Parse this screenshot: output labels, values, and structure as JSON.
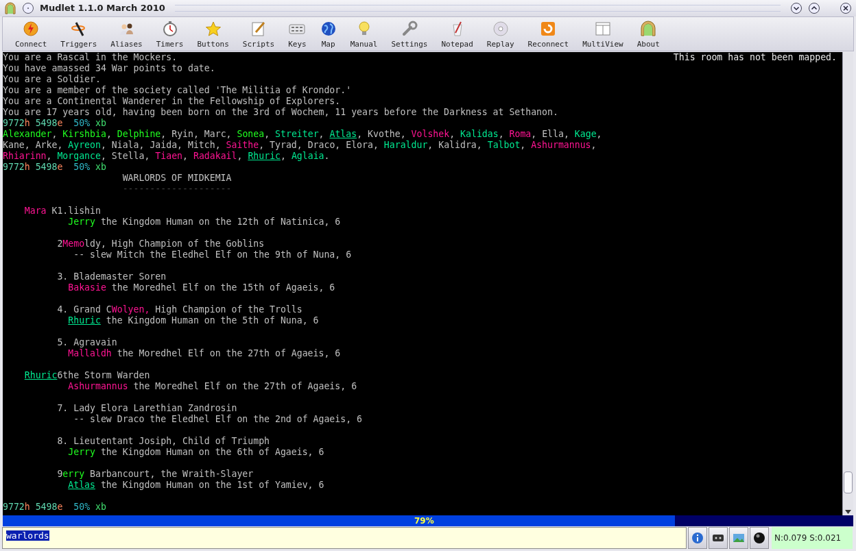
{
  "window": {
    "title": "Mudlet 1.1.0 March 2010"
  },
  "toolbar": [
    {
      "label": "Connect"
    },
    {
      "label": "Triggers"
    },
    {
      "label": "Aliases"
    },
    {
      "label": "Timers"
    },
    {
      "label": "Buttons"
    },
    {
      "label": "Scripts"
    },
    {
      "label": "Keys"
    },
    {
      "label": "Map"
    },
    {
      "label": "Manual"
    },
    {
      "label": "Settings"
    },
    {
      "label": "Notepad"
    },
    {
      "label": "Replay"
    },
    {
      "label": "Reconnect"
    },
    {
      "label": "MultiView"
    },
    {
      "label": "About"
    }
  ],
  "console": {
    "map_note": "This room has not been mapped.",
    "lines": [
      {
        "kind": "text",
        "segments": [
          {
            "text": "You are a Rascal in the Mockers."
          }
        ]
      },
      {
        "kind": "text",
        "segments": [
          {
            "text": "You have amassed 34 War points to date."
          }
        ]
      },
      {
        "kind": "text",
        "segments": [
          {
            "text": "You are a Soldier."
          }
        ]
      },
      {
        "kind": "text",
        "segments": [
          {
            "text": "You are a member of the society called 'The Militia of Krondor.'"
          }
        ]
      },
      {
        "kind": "text",
        "segments": [
          {
            "text": "You are a Continental Wanderer in the Fellowship of Explorers."
          }
        ]
      },
      {
        "kind": "text",
        "segments": [
          {
            "text": "You are 17 years old, having been born on the 3rd of Wochem, 11 years before the Darkness at Sethanon."
          }
        ]
      },
      {
        "kind": "text",
        "segments": [
          {
            "text": "9772",
            "color": "#5fd7af"
          },
          {
            "text": "h",
            "color": "#ff875f"
          },
          {
            "text": " 5498",
            "color": "#5fd7af"
          },
          {
            "text": "e",
            "color": "#ff875f"
          },
          {
            "text": "  50%",
            "color": "#30b8c8"
          },
          {
            "text": " xb",
            "color": "#40e070"
          }
        ]
      },
      {
        "kind": "text",
        "segments": [
          {
            "text": "Alexander",
            "color": "#20ff20"
          },
          {
            "text": ", "
          },
          {
            "text": "Kirshbia",
            "color": "#20ff20"
          },
          {
            "text": ", "
          },
          {
            "text": "Delphine",
            "color": "#20ff20"
          },
          {
            "text": ", Ryin, Marc, "
          },
          {
            "text": "Sonea",
            "color": "#20ff20"
          },
          {
            "text": ", "
          },
          {
            "text": "Streiter",
            "color": "#00e890"
          },
          {
            "text": ", "
          },
          {
            "text": "Atlas",
            "color": "#00e890",
            "underline": true
          },
          {
            "text": ", Kvothe, "
          },
          {
            "text": "Volshek",
            "color": "#ff1493"
          },
          {
            "text": ", "
          },
          {
            "text": "Kalidas",
            "color": "#00e890"
          },
          {
            "text": ", "
          },
          {
            "text": "Roma",
            "color": "#ff1493"
          },
          {
            "text": ", Ella, "
          },
          {
            "text": "Kage",
            "color": "#00e890"
          },
          {
            "text": ","
          }
        ]
      },
      {
        "kind": "text",
        "segments": [
          {
            "text": "Kane, Arke, "
          },
          {
            "text": "Ayreon",
            "color": "#00e890"
          },
          {
            "text": ", Niala, Jaida, Mitch, "
          },
          {
            "text": "Saithe",
            "color": "#ff1493"
          },
          {
            "text": ", Tyrad, Draco, Elora, "
          },
          {
            "text": "Haraldur",
            "color": "#00e890"
          },
          {
            "text": ", Kalidra, "
          },
          {
            "text": "Talbot",
            "color": "#00e890"
          },
          {
            "text": ", "
          },
          {
            "text": "Ashurmannus",
            "color": "#ff1493"
          },
          {
            "text": ","
          }
        ]
      },
      {
        "kind": "text",
        "segments": [
          {
            "text": "Rhiarinn",
            "color": "#ff1493"
          },
          {
            "text": ", "
          },
          {
            "text": "Morgance",
            "color": "#00e890"
          },
          {
            "text": ", Stella, "
          },
          {
            "text": "Tiaen",
            "color": "#ff1493"
          },
          {
            "text": ", "
          },
          {
            "text": "Radakail",
            "color": "#ff1493"
          },
          {
            "text": ", "
          },
          {
            "text": "Rhuric",
            "color": "#00e890",
            "underline": true
          },
          {
            "text": ", "
          },
          {
            "text": "Aglaia",
            "color": "#00e890"
          },
          {
            "text": "."
          }
        ]
      },
      {
        "kind": "text",
        "segments": [
          {
            "text": "9772",
            "color": "#5fd7af"
          },
          {
            "text": "h",
            "color": "#ff875f"
          },
          {
            "text": " 5498",
            "color": "#5fd7af"
          },
          {
            "text": "e",
            "color": "#ff875f"
          },
          {
            "text": "  50%",
            "color": "#30b8c8"
          },
          {
            "text": " xb",
            "color": "#40e070"
          }
        ]
      },
      {
        "kind": "text",
        "segments": [
          {
            "text": "                      WARLORDS OF MIDKEMIA"
          }
        ]
      },
      {
        "kind": "text",
        "segments": [
          {
            "text": "                      --------------------",
            "color": "#404040"
          }
        ]
      },
      {
        "kind": "blank"
      },
      {
        "kind": "text",
        "segments": [
          {
            "text": "    Mara",
            "color": "#ff1493"
          },
          {
            "text": " K1.lishin"
          }
        ]
      },
      {
        "kind": "text",
        "segments": [
          {
            "text": "            Jerry",
            "color": "#20ff20"
          },
          {
            "text": " the Kingdom Human on the 12th of Natinica, 6"
          }
        ]
      },
      {
        "kind": "blank"
      },
      {
        "kind": "text",
        "segments": [
          {
            "text": "          2"
          },
          {
            "text": "Memo",
            "color": "#ff1493"
          },
          {
            "text": "ldy, High Champion of the Goblins"
          }
        ]
      },
      {
        "kind": "text",
        "segments": [
          {
            "text": "             -- slew Mitch the Eledhel Elf on the 9th of Nuna, 6"
          }
        ]
      },
      {
        "kind": "blank"
      },
      {
        "kind": "text",
        "segments": [
          {
            "text": "          3. Blademaster Soren"
          }
        ]
      },
      {
        "kind": "text",
        "segments": [
          {
            "text": "            Bakasie",
            "color": "#ff1493"
          },
          {
            "text": " the Moredhel Elf on the 15th of Agaeis, 6"
          }
        ]
      },
      {
        "kind": "blank"
      },
      {
        "kind": "text",
        "segments": [
          {
            "text": "          4. Grand C"
          },
          {
            "text": "Wolyen,",
            "color": "#ff1493"
          },
          {
            "text": " High Champion of the Trolls"
          }
        ]
      },
      {
        "kind": "text",
        "segments": [
          {
            "text": "            Rhuric",
            "color": "#00e890",
            "underline": true
          },
          {
            "text": " the Kingdom Human on the 5th of Nuna, 6"
          }
        ]
      },
      {
        "kind": "blank"
      },
      {
        "kind": "text",
        "segments": [
          {
            "text": "          5. Agravain"
          }
        ]
      },
      {
        "kind": "text",
        "segments": [
          {
            "text": "            Mallaldh",
            "color": "#ff1493"
          },
          {
            "text": " the Moredhel Elf on the 27th of Agaeis, 6"
          }
        ]
      },
      {
        "kind": "blank"
      },
      {
        "kind": "text",
        "segments": [
          {
            "text": "    Rhuric",
            "color": "#00e890",
            "underline": true
          },
          {
            "text": "6the Storm Warden"
          }
        ]
      },
      {
        "kind": "text",
        "segments": [
          {
            "text": "            Ashurmannus",
            "color": "#ff1493"
          },
          {
            "text": " the Moredhel Elf on the 27th of Agaeis, 6"
          }
        ]
      },
      {
        "kind": "blank"
      },
      {
        "kind": "text",
        "segments": [
          {
            "text": "          7. Lady Elora Larethian Zandrosin"
          }
        ]
      },
      {
        "kind": "text",
        "segments": [
          {
            "text": "             -- slew Draco the Eledhel Elf on the 2nd of Agaeis, 6"
          }
        ]
      },
      {
        "kind": "blank"
      },
      {
        "kind": "text",
        "segments": [
          {
            "text": "          8. Lieutentant Josiph, Child of Triumph"
          }
        ]
      },
      {
        "kind": "text",
        "segments": [
          {
            "text": "            Jerry",
            "color": "#20ff20"
          },
          {
            "text": " the Kingdom Human on the 6th of Agaeis, 6"
          }
        ]
      },
      {
        "kind": "blank"
      },
      {
        "kind": "text",
        "segments": [
          {
            "text": "          9"
          },
          {
            "text": "erry",
            "color": "#20ff20"
          },
          {
            "text": " Barbancourt, the Wraith-Slayer"
          }
        ]
      },
      {
        "kind": "text",
        "segments": [
          {
            "text": "            Atlas",
            "color": "#00e890",
            "underline": true
          },
          {
            "text": " the Kingdom Human on the 1st of Yamiev, 6"
          }
        ]
      },
      {
        "kind": "blank"
      },
      {
        "kind": "text",
        "segments": [
          {
            "text": "9772",
            "color": "#5fd7af"
          },
          {
            "text": "h",
            "color": "#ff875f"
          },
          {
            "text": " 5498",
            "color": "#5fd7af"
          },
          {
            "text": "e",
            "color": "#ff875f"
          },
          {
            "text": "  50%",
            "color": "#30b8c8"
          },
          {
            "text": " xb",
            "color": "#40e070"
          }
        ]
      }
    ]
  },
  "progress": {
    "level": 0.79,
    "label": "79%"
  },
  "command_line": {
    "value": "warlords",
    "selected": true
  },
  "status": "N:0.079 S:0.021"
}
